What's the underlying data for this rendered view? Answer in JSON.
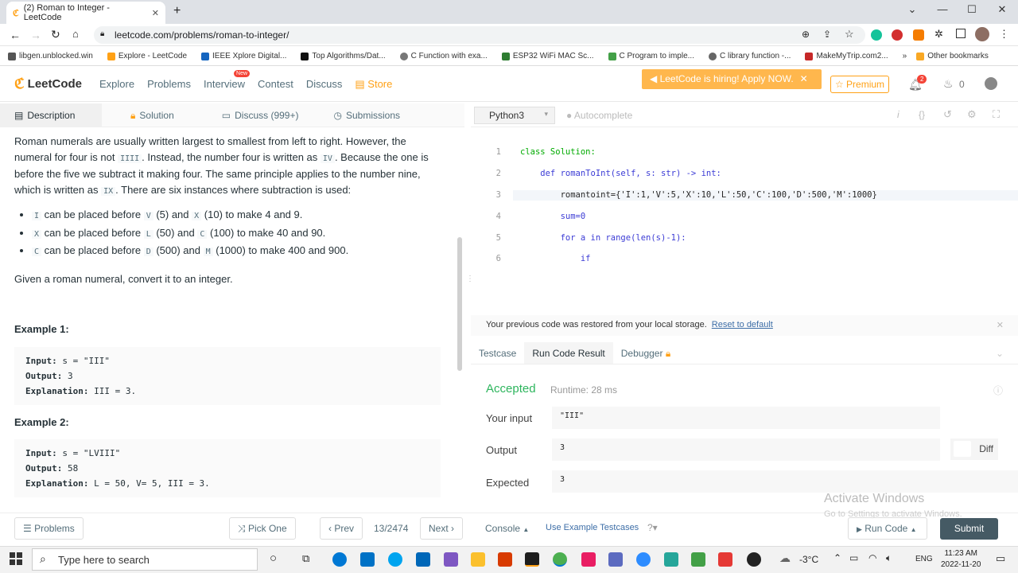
{
  "browser": {
    "tab_title": "(2) Roman to Integer - LeetCode",
    "url": "leetcode.com/problems/roman-to-integer/",
    "bookmarks": [
      "libgen.unblocked.win",
      "Explore - LeetCode",
      "IEEE Xplore Digital...",
      "Top Algorithms/Dat...",
      "C Function with exa...",
      "ESP32 WiFi MAC Sc...",
      "C Program to imple...",
      "C library function -...",
      "MakeMyTrip.com2...",
      "Other bookmarks"
    ]
  },
  "nav": {
    "logo": "LeetCode",
    "items": [
      "Explore",
      "Problems",
      "Interview",
      "Contest",
      "Discuss",
      "Store"
    ],
    "new_badge": "New",
    "hiring": "LeetCode is hiring! Apply NOW.",
    "premium": "Premium",
    "notif_count": "2",
    "coins": "0"
  },
  "left_tabs": [
    "Description",
    "Solution",
    "Discuss (999+)",
    "Submissions"
  ],
  "desc": {
    "p1a": "Roman numerals are usually written largest to smallest from left to right. However, the numeral for four is not ",
    "p1code1": "IIII",
    "p1b": ". Instead, the number four is written as ",
    "p1code2": "IV",
    "p1c": ". Because the one is before the five we subtract it making four. The same principle applies to the number nine, which is written as ",
    "p1code3": "IX",
    "p1d": ". There are six instances where subtraction is used:",
    "bullets": [
      {
        "c1": "I",
        "t1": " can be placed before ",
        "c2": "V",
        "t2": " (5) and ",
        "c3": "X",
        "t3": " (10) to make 4 and 9."
      },
      {
        "c1": "X",
        "t1": " can be placed before ",
        "c2": "L",
        "t2": " (50) and ",
        "c3": "C",
        "t3": " (100) to make 40 and 90."
      },
      {
        "c1": "C",
        "t1": " can be placed before ",
        "c2": "D",
        "t2": " (500) and ",
        "c3": "M",
        "t3": " (1000) to make 400 and 900."
      }
    ],
    "p2": "Given a roman numeral, convert it to an integer.",
    "ex1_title": "Example 1:",
    "ex1_input_label": "Input:",
    "ex1_input": " s = \"III\"",
    "ex1_output_label": "Output:",
    "ex1_output": " 3",
    "ex1_expl_label": "Explanation:",
    "ex1_expl": " III = 3.",
    "ex2_title": "Example 2:",
    "ex2_input_label": "Input:",
    "ex2_input": " s = \"LVIII\"",
    "ex2_output_label": "Output:",
    "ex2_output": " 58",
    "ex2_expl_label": "Explanation:",
    "ex2_expl": " L = 50, V= 5, III = 3."
  },
  "editor": {
    "language": "Python3",
    "autocomplete": "Autocomplete",
    "lines": [
      "class Solution:",
      "    def romanToInt(self, s: str) -> int:",
      "        romantoint={'I':1,'V':5,'X':10,'L':50,'C':100,'D':500,'M':1000}",
      "        sum=0",
      "        for a in range(len(s)-1):",
      "            if"
    ],
    "line_numbers": [
      "1",
      "2",
      "3",
      "4",
      "5",
      "6"
    ]
  },
  "result": {
    "restore_msg": "Your previous code was restored from your local storage.",
    "reset_link": "Reset to default",
    "tabs": [
      "Testcase",
      "Run Code Result",
      "Debugger"
    ],
    "status": "Accepted",
    "runtime": "Runtime: 28 ms",
    "your_input_label": "Your input",
    "your_input": "\"III\"",
    "output_label": "Output",
    "output": "3",
    "expected_label": "Expected",
    "expected": "3",
    "diff": "Diff"
  },
  "bottom": {
    "problems": "Problems",
    "pick_one": "Pick One",
    "prev": "Prev",
    "page": "13/2474",
    "next": "Next",
    "console": "Console",
    "use_example": "Use Example Testcases",
    "run_code": "Run Code",
    "submit": "Submit",
    "activate1": "Activate Windows",
    "activate2": "Go to Settings to activate Windows."
  },
  "taskbar": {
    "search_placeholder": "Type here to search",
    "weather": "-3°C",
    "lang": "ENG",
    "time": "11:23 AM",
    "date": "2022-11-20"
  }
}
